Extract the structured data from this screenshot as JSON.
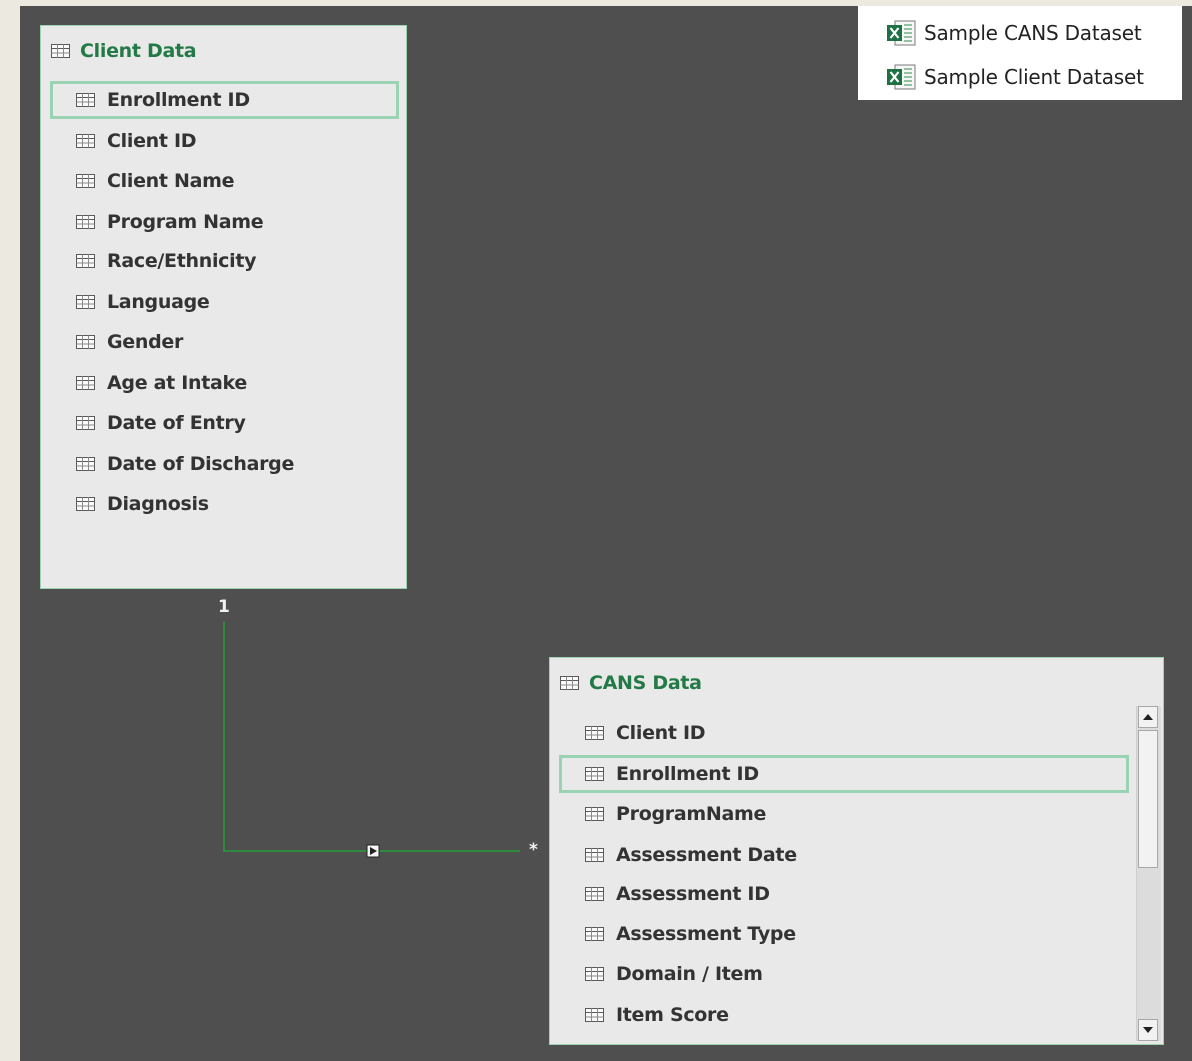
{
  "colors": {
    "canvas": "#4f4f4f",
    "table_fill": "#e9e9e9",
    "table_border": "#9ad3b4",
    "title_green": "#237a47",
    "relationship_line": "#2e8b3e"
  },
  "legend": {
    "items": [
      {
        "label": "Sample CANS Dataset",
        "icon": "excel-icon"
      },
      {
        "label": "Sample Client Dataset",
        "icon": "excel-icon"
      }
    ]
  },
  "client_table": {
    "title": "Client Data",
    "icon": "table-grid-icon",
    "fields": [
      {
        "label": "Enrollment ID",
        "selected": true
      },
      {
        "label": "Client ID"
      },
      {
        "label": "Client Name"
      },
      {
        "label": "Program Name"
      },
      {
        "label": "Race/Ethnicity"
      },
      {
        "label": "Language"
      },
      {
        "label": "Gender"
      },
      {
        "label": "Age at Intake"
      },
      {
        "label": "Date of Entry"
      },
      {
        "label": "Date of Discharge"
      },
      {
        "label": "Diagnosis"
      }
    ]
  },
  "cans_table": {
    "title": "CANS Data",
    "icon": "table-grid-icon",
    "fields": [
      {
        "label": "Client ID"
      },
      {
        "label": "Enrollment ID",
        "selected": true
      },
      {
        "label": "ProgramName"
      },
      {
        "label": "Assessment Date"
      },
      {
        "label": "Assessment ID"
      },
      {
        "label": "Assessment Type"
      },
      {
        "label": "Domain / Item"
      },
      {
        "label": "Item Score"
      }
    ]
  },
  "relationship": {
    "one_label": "1",
    "many_label": "*"
  }
}
